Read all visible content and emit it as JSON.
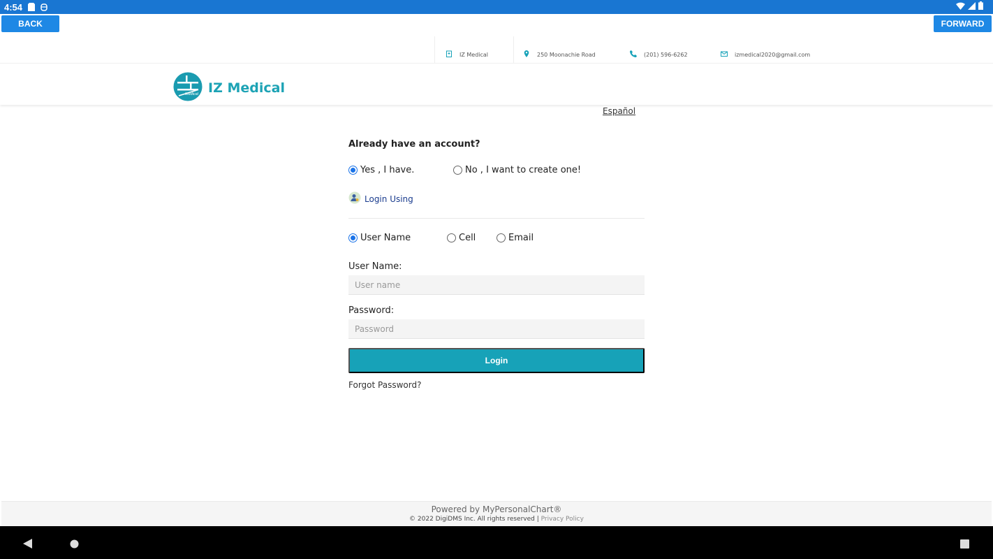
{
  "status_bar": {
    "time": "4:54",
    "icons": [
      "sd-card-icon",
      "debug-icon"
    ],
    "right_icons": [
      "wifi-icon",
      "signal-icon",
      "battery-icon"
    ]
  },
  "nav": {
    "back_label": "BACK",
    "forward_label": "FORWARD"
  },
  "contact": {
    "clinic": "IZ Medical",
    "address": "250 Moonachie Road",
    "phone": "(201) 596-6262",
    "email": "izmedical2020@gmail.com"
  },
  "header": {
    "brand": "IZ Medical",
    "logo_small_text": "Medical"
  },
  "language_link": "Español",
  "form": {
    "question": "Already have an account?",
    "account_options": [
      {
        "label": "Yes , I have.",
        "checked": true
      },
      {
        "label": "No , I want to create one!",
        "checked": false
      }
    ],
    "login_using": "Login Using",
    "method_options": [
      {
        "label": "User Name",
        "checked": true
      },
      {
        "label": "Cell",
        "checked": false
      },
      {
        "label": "Email",
        "checked": false
      }
    ],
    "username_label": "User Name:",
    "username_placeholder": "User name",
    "password_label": "Password:",
    "password_placeholder": "Password",
    "login_button": "Login",
    "forgot_password": "Forgot Password?"
  },
  "footer": {
    "powered_by": "Powered by MyPersonalChart®",
    "copyright": "© 2022 DigiDMS Inc. All rights reserved | ",
    "privacy": "Privacy Policy"
  },
  "colors": {
    "accent": "#17a2b8",
    "status_bar": "#1976d2",
    "nav_button": "#1e88e5",
    "brand": "#1da3b5"
  }
}
